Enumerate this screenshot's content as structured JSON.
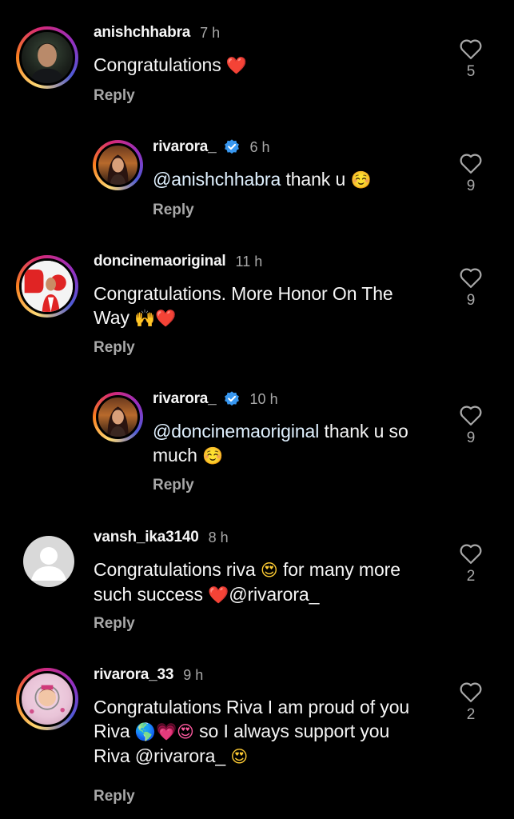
{
  "comments": [
    {
      "username": "anishchhabra",
      "time": "7 h",
      "text": "Congratulations",
      "emoji": "❤️",
      "likes": "5",
      "reply_label": "Reply"
    },
    {
      "username": "rivarora_",
      "time": "6 h",
      "mention": "@anishchhabra",
      "text": " thank u ",
      "emoji": "☺️",
      "likes": "9",
      "reply_label": "Reply"
    },
    {
      "username": "doncinemaoriginal",
      "time": "11 h",
      "text_line1": "Congratulations. More Honor On The",
      "text_line2": "Way",
      "emoji": "🙌❤️",
      "likes": "9",
      "reply_label": "Reply"
    },
    {
      "username": "rivarora_",
      "time": "10 h",
      "mention": "@doncinemaoriginal",
      "text_line1": " thank u so",
      "text_line2": "much",
      "emoji": "☺️",
      "likes": "9",
      "reply_label": "Reply"
    },
    {
      "username": "vansh_ika3140",
      "time": "8 h",
      "text_line1a": "Congratulations riva",
      "emoji1": "😍",
      "text_line1b": "for many more",
      "text_line2": "such success",
      "emoji2": "❤️",
      "mention": "@rivarora_",
      "likes": "2",
      "reply_label": "Reply"
    },
    {
      "username": "rivarora_33",
      "time": "9 h",
      "text_line1": "Congratulations Riva I am proud of you",
      "text_line2a": "Riva",
      "emoji2": "🌎💗😍",
      "text_line2b": "so I always support you",
      "text_line3a": "Riva",
      "mention": "@rivarora_",
      "emoji3": "😍",
      "likes": "2",
      "reply_label": "Reply"
    }
  ],
  "colors": {
    "background": "#000000",
    "secondary_text": "#a8a8a8",
    "verified_blue": "#3897f0",
    "heart_red": "#ff2b3b"
  }
}
